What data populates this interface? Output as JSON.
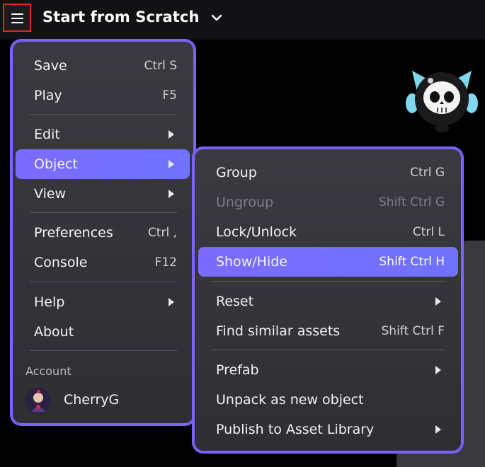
{
  "header": {
    "title": "Start from Scratch"
  },
  "main_menu": {
    "items": [
      {
        "label": "Save",
        "shortcut": "Ctrl S"
      },
      {
        "label": "Play",
        "shortcut": "F5"
      },
      {
        "label": "Edit"
      },
      {
        "label": "Object"
      },
      {
        "label": "View"
      },
      {
        "label": "Preferences",
        "shortcut": "Ctrl ,"
      },
      {
        "label": "Console",
        "shortcut": "F12"
      },
      {
        "label": "Help"
      },
      {
        "label": "About"
      }
    ],
    "account_label": "Account",
    "username": "CherryG"
  },
  "object_submenu": {
    "items": [
      {
        "label": "Group",
        "shortcut": "Ctrl G"
      },
      {
        "label": "Ungroup",
        "shortcut": "Shift Ctrl G"
      },
      {
        "label": "Lock/Unlock",
        "shortcut": "Ctrl L"
      },
      {
        "label": "Show/Hide",
        "shortcut": "Shift Ctrl H"
      },
      {
        "label": "Reset"
      },
      {
        "label": "Find similar assets",
        "shortcut": "Shift Ctrl F"
      },
      {
        "label": "Prefab"
      },
      {
        "label": "Unpack as new object"
      },
      {
        "label": "Publish to Asset Library"
      }
    ]
  },
  "colors": {
    "accent": "#7b6bff",
    "menu_border": "#7a63ff",
    "highlight_box": "#e5231b",
    "menu_bg": "#34343a"
  },
  "icons": {
    "menu": "hamburger-icon",
    "title_dropdown": "chevron-down-icon",
    "submenu": "chevron-right-icon"
  }
}
